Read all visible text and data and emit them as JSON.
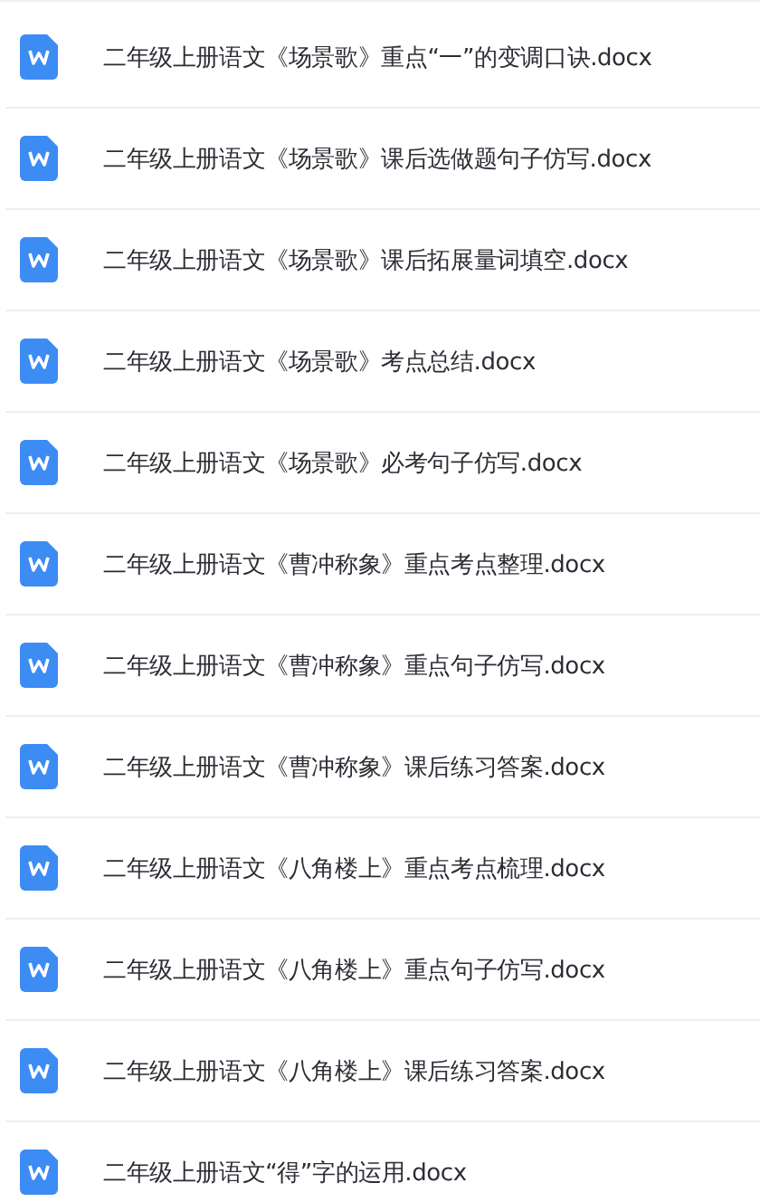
{
  "files": [
    {
      "name": "二年级上册语文《场景歌》重点“一”的变调口诀.docx"
    },
    {
      "name": "二年级上册语文《场景歌》课后选做题句子仿写.docx"
    },
    {
      "name": "二年级上册语文《场景歌》课后拓展量词填空.docx"
    },
    {
      "name": "二年级上册语文《场景歌》考点总结.docx"
    },
    {
      "name": "二年级上册语文《场景歌》必考句子仿写.docx"
    },
    {
      "name": "二年级上册语文《曹冲称象》重点考点整理.docx"
    },
    {
      "name": "二年级上册语文《曹冲称象》重点句子仿写.docx"
    },
    {
      "name": "二年级上册语文《曹冲称象》课后练习答案.docx"
    },
    {
      "name": "二年级上册语文《八角楼上》重点考点梳理.docx"
    },
    {
      "name": "二年级上册语文《八角楼上》重点句子仿写.docx"
    },
    {
      "name": "二年级上册语文《八角楼上》课后练习答案.docx"
    },
    {
      "name": "二年级上册语文“得”字的运用.docx"
    }
  ]
}
